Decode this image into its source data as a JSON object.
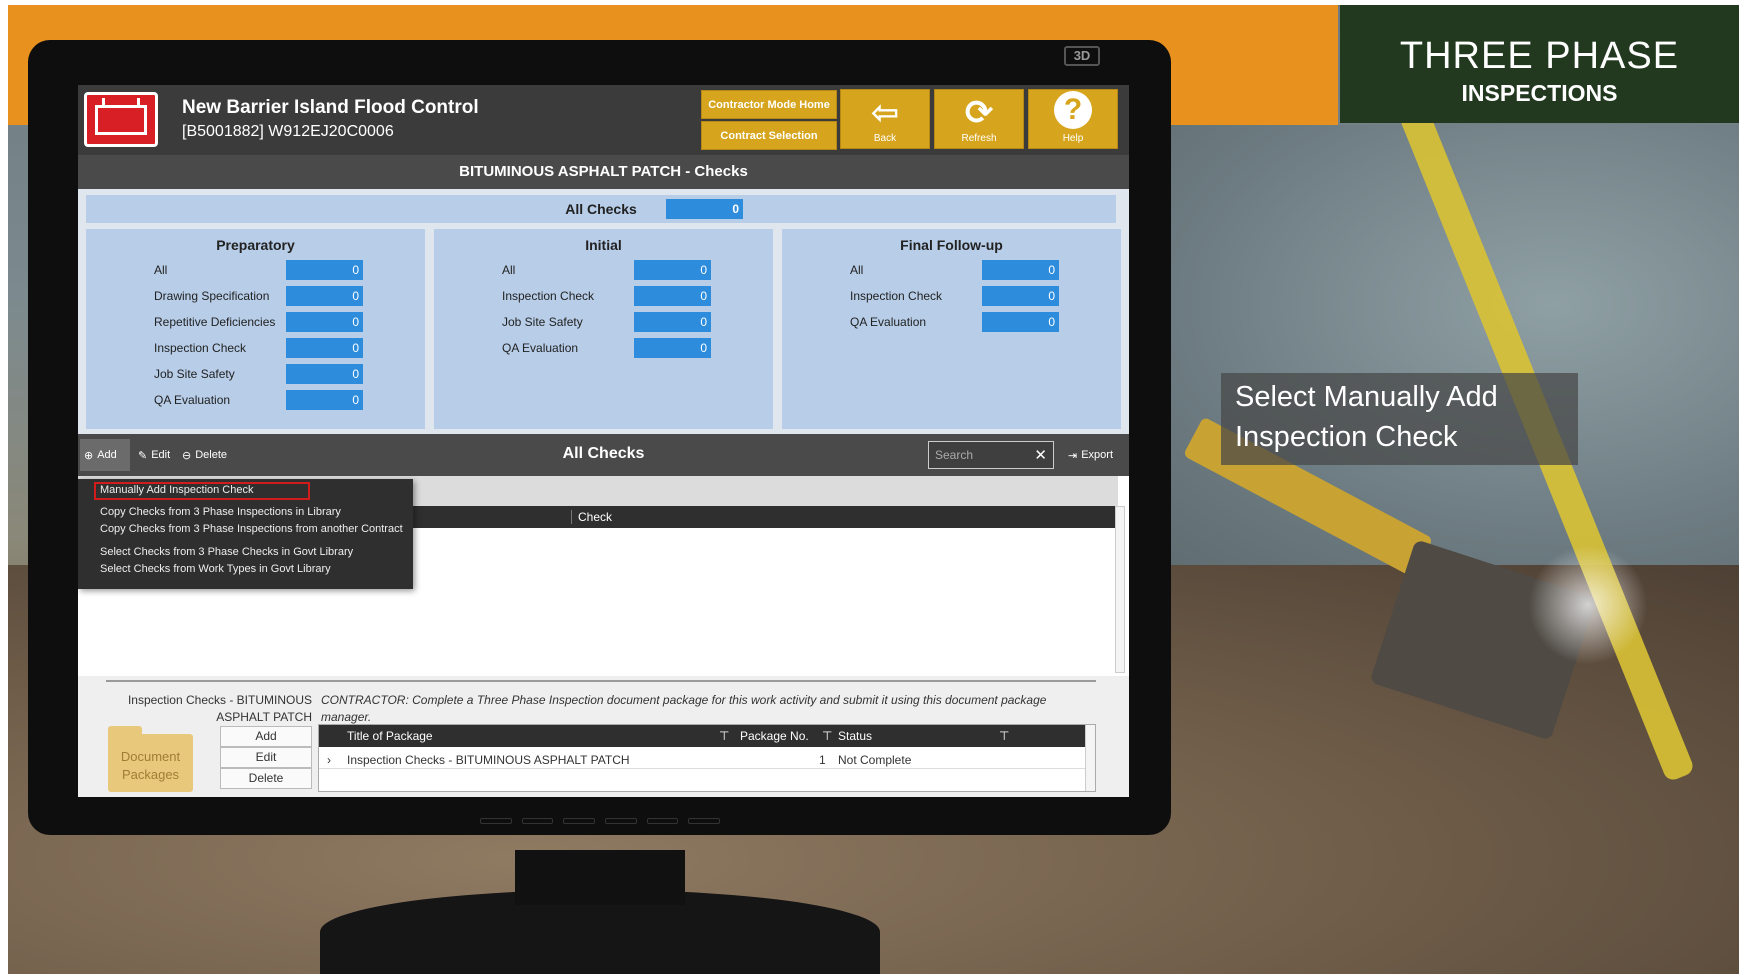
{
  "brand": {
    "line1": "THREE PHASE",
    "line2": "INSPECTIONS"
  },
  "callout": {
    "text": "Select Manually Add Inspection Check"
  },
  "monitor": {
    "badge": "3D"
  },
  "app": {
    "project_name": "New Barrier Island Flood Control",
    "project_id": "[B5001882] W912EJ20C0006",
    "contractor_mode_home": "Contractor Mode Home",
    "contract_selection": "Contract Selection",
    "back_label": "Back",
    "refresh_label": "Refresh",
    "help_label": "Help",
    "title": "BITUMINOUS ASPHALT PATCH - Checks"
  },
  "summary": {
    "all_checks_label": "All Checks",
    "all_checks_value": "0",
    "panels": [
      {
        "title": "Preparatory",
        "rows": [
          {
            "label": "All",
            "value": "0"
          },
          {
            "label": "Drawing Specification",
            "value": "0"
          },
          {
            "label": "Repetitive Deficiencies",
            "value": "0"
          },
          {
            "label": "Inspection Check",
            "value": "0"
          },
          {
            "label": "Job Site Safety",
            "value": "0"
          },
          {
            "label": "QA Evaluation",
            "value": "0"
          }
        ]
      },
      {
        "title": "Initial",
        "rows": [
          {
            "label": "All",
            "value": "0"
          },
          {
            "label": "Inspection Check",
            "value": "0"
          },
          {
            "label": "Job Site Safety",
            "value": "0"
          },
          {
            "label": "QA Evaluation",
            "value": "0"
          }
        ]
      },
      {
        "title": "Final Follow-up",
        "rows": [
          {
            "label": "All",
            "value": "0"
          },
          {
            "label": "Inspection Check",
            "value": "0"
          },
          {
            "label": "QA Evaluation",
            "value": "0"
          }
        ]
      }
    ]
  },
  "toolbar": {
    "add_label": "Add",
    "edit_label": "Edit",
    "delete_label": "Delete",
    "title": "All Checks",
    "search_placeholder": "Search",
    "export_label": "Export"
  },
  "dropdown": {
    "items": [
      "Manually Add Inspection Check",
      "Copy Checks from 3 Phase Inspections in Library",
      "Copy Checks from 3 Phase Inspections from another Contract",
      "Select Checks from 3 Phase Checks in Govt Library",
      "Select Checks from Work Types in Govt Library"
    ]
  },
  "grid": {
    "check_column": "Check"
  },
  "bottom": {
    "section_title": "Inspection Checks - BITUMINOUS ASPHALT PATCH",
    "description": "CONTRACTOR: Complete a Three Phase Inspection document package for this work activity and submit it using this document package manager.",
    "folder_label": "Document Packages",
    "add": "Add",
    "edit": "Edit",
    "delete": "Delete",
    "table": {
      "columns": [
        "Title of Package",
        "Package No.",
        "Status"
      ],
      "rows": [
        {
          "title": "Inspection Checks - BITUMINOUS ASPHALT PATCH",
          "package_no": "1",
          "status": "Not Complete"
        }
      ]
    }
  }
}
